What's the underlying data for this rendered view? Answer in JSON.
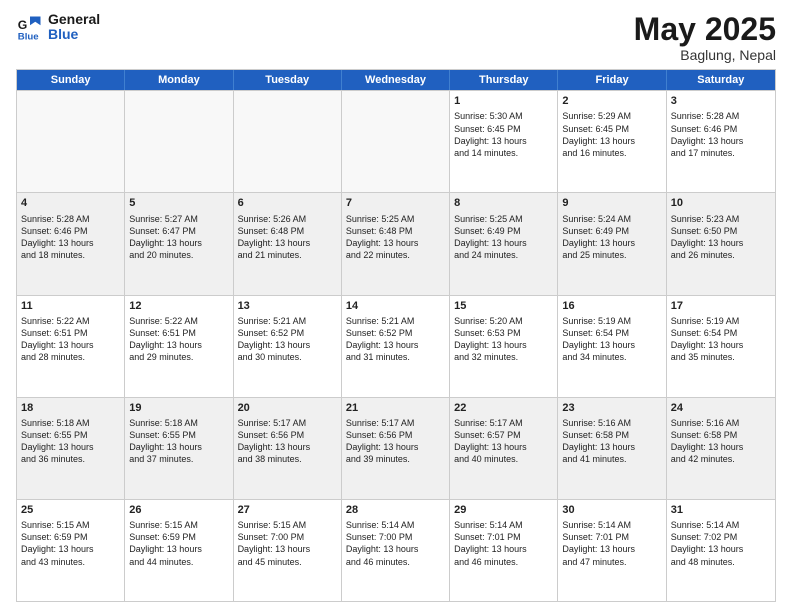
{
  "logo": {
    "line1": "General",
    "line2": "Blue"
  },
  "title": "May 2025",
  "subtitle": "Baglung, Nepal",
  "days": [
    "Sunday",
    "Monday",
    "Tuesday",
    "Wednesday",
    "Thursday",
    "Friday",
    "Saturday"
  ],
  "weeks": [
    [
      {
        "day": "",
        "info": ""
      },
      {
        "day": "",
        "info": ""
      },
      {
        "day": "",
        "info": ""
      },
      {
        "day": "",
        "info": ""
      },
      {
        "day": "1",
        "info": "Sunrise: 5:30 AM\nSunset: 6:45 PM\nDaylight: 13 hours\nand 14 minutes."
      },
      {
        "day": "2",
        "info": "Sunrise: 5:29 AM\nSunset: 6:45 PM\nDaylight: 13 hours\nand 16 minutes."
      },
      {
        "day": "3",
        "info": "Sunrise: 5:28 AM\nSunset: 6:46 PM\nDaylight: 13 hours\nand 17 minutes."
      }
    ],
    [
      {
        "day": "4",
        "info": "Sunrise: 5:28 AM\nSunset: 6:46 PM\nDaylight: 13 hours\nand 18 minutes."
      },
      {
        "day": "5",
        "info": "Sunrise: 5:27 AM\nSunset: 6:47 PM\nDaylight: 13 hours\nand 20 minutes."
      },
      {
        "day": "6",
        "info": "Sunrise: 5:26 AM\nSunset: 6:48 PM\nDaylight: 13 hours\nand 21 minutes."
      },
      {
        "day": "7",
        "info": "Sunrise: 5:25 AM\nSunset: 6:48 PM\nDaylight: 13 hours\nand 22 minutes."
      },
      {
        "day": "8",
        "info": "Sunrise: 5:25 AM\nSunset: 6:49 PM\nDaylight: 13 hours\nand 24 minutes."
      },
      {
        "day": "9",
        "info": "Sunrise: 5:24 AM\nSunset: 6:49 PM\nDaylight: 13 hours\nand 25 minutes."
      },
      {
        "day": "10",
        "info": "Sunrise: 5:23 AM\nSunset: 6:50 PM\nDaylight: 13 hours\nand 26 minutes."
      }
    ],
    [
      {
        "day": "11",
        "info": "Sunrise: 5:22 AM\nSunset: 6:51 PM\nDaylight: 13 hours\nand 28 minutes."
      },
      {
        "day": "12",
        "info": "Sunrise: 5:22 AM\nSunset: 6:51 PM\nDaylight: 13 hours\nand 29 minutes."
      },
      {
        "day": "13",
        "info": "Sunrise: 5:21 AM\nSunset: 6:52 PM\nDaylight: 13 hours\nand 30 minutes."
      },
      {
        "day": "14",
        "info": "Sunrise: 5:21 AM\nSunset: 6:52 PM\nDaylight: 13 hours\nand 31 minutes."
      },
      {
        "day": "15",
        "info": "Sunrise: 5:20 AM\nSunset: 6:53 PM\nDaylight: 13 hours\nand 32 minutes."
      },
      {
        "day": "16",
        "info": "Sunrise: 5:19 AM\nSunset: 6:54 PM\nDaylight: 13 hours\nand 34 minutes."
      },
      {
        "day": "17",
        "info": "Sunrise: 5:19 AM\nSunset: 6:54 PM\nDaylight: 13 hours\nand 35 minutes."
      }
    ],
    [
      {
        "day": "18",
        "info": "Sunrise: 5:18 AM\nSunset: 6:55 PM\nDaylight: 13 hours\nand 36 minutes."
      },
      {
        "day": "19",
        "info": "Sunrise: 5:18 AM\nSunset: 6:55 PM\nDaylight: 13 hours\nand 37 minutes."
      },
      {
        "day": "20",
        "info": "Sunrise: 5:17 AM\nSunset: 6:56 PM\nDaylight: 13 hours\nand 38 minutes."
      },
      {
        "day": "21",
        "info": "Sunrise: 5:17 AM\nSunset: 6:56 PM\nDaylight: 13 hours\nand 39 minutes."
      },
      {
        "day": "22",
        "info": "Sunrise: 5:17 AM\nSunset: 6:57 PM\nDaylight: 13 hours\nand 40 minutes."
      },
      {
        "day": "23",
        "info": "Sunrise: 5:16 AM\nSunset: 6:58 PM\nDaylight: 13 hours\nand 41 minutes."
      },
      {
        "day": "24",
        "info": "Sunrise: 5:16 AM\nSunset: 6:58 PM\nDaylight: 13 hours\nand 42 minutes."
      }
    ],
    [
      {
        "day": "25",
        "info": "Sunrise: 5:15 AM\nSunset: 6:59 PM\nDaylight: 13 hours\nand 43 minutes."
      },
      {
        "day": "26",
        "info": "Sunrise: 5:15 AM\nSunset: 6:59 PM\nDaylight: 13 hours\nand 44 minutes."
      },
      {
        "day": "27",
        "info": "Sunrise: 5:15 AM\nSunset: 7:00 PM\nDaylight: 13 hours\nand 45 minutes."
      },
      {
        "day": "28",
        "info": "Sunrise: 5:14 AM\nSunset: 7:00 PM\nDaylight: 13 hours\nand 46 minutes."
      },
      {
        "day": "29",
        "info": "Sunrise: 5:14 AM\nSunset: 7:01 PM\nDaylight: 13 hours\nand 46 minutes."
      },
      {
        "day": "30",
        "info": "Sunrise: 5:14 AM\nSunset: 7:01 PM\nDaylight: 13 hours\nand 47 minutes."
      },
      {
        "day": "31",
        "info": "Sunrise: 5:14 AM\nSunset: 7:02 PM\nDaylight: 13 hours\nand 48 minutes."
      }
    ]
  ]
}
